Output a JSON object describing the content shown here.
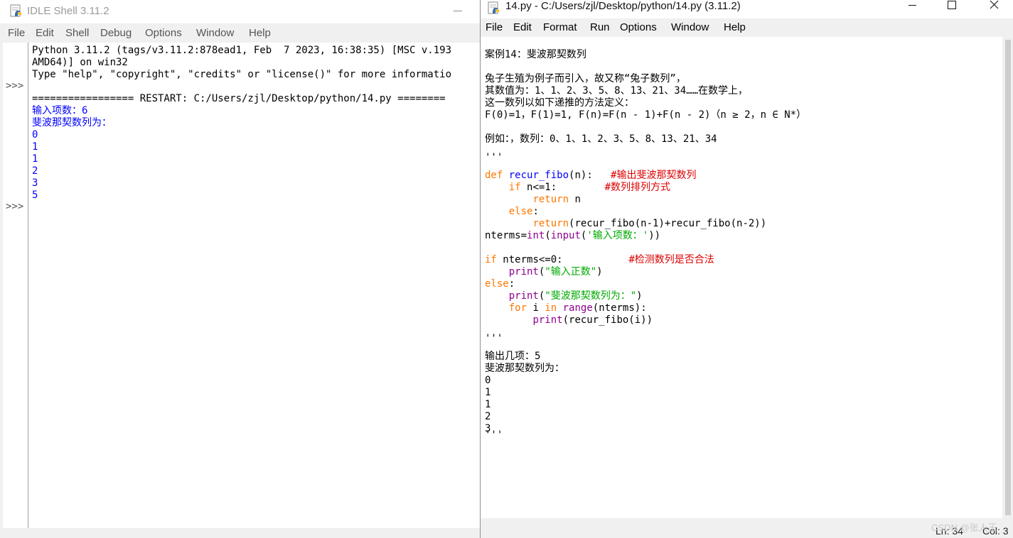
{
  "shell": {
    "title": "IDLE Shell 3.11.2",
    "menu": [
      "File",
      "Edit",
      "Shell",
      "Debug",
      "Options",
      "Window",
      "Help"
    ],
    "prompt": ">>>",
    "lines": [
      "Python 3.11.2 (tags/v3.11.2:878ead1, Feb  7 2023, 16:38:35) [MSC v.193",
      "AMD64)] on win32",
      "Type \"help\", \"copyright\", \"credits\" or \"license()\" for more informatio",
      "",
      "================= RESTART: C:/Users/zjl/Desktop/python/14.py ========",
      "输入项数：6",
      "斐波那契数列为：",
      "0",
      "1",
      "1",
      "2",
      "3",
      "5"
    ]
  },
  "editor": {
    "title": "14.py - C:/Users/zjl/Desktop/python/14.py (3.11.2)",
    "menu": [
      "File",
      "Edit",
      "Format",
      "Run",
      "Options",
      "Window",
      "Help"
    ],
    "code": {
      "l0": "'''",
      "l1": "案例14：斐波那契数列",
      "l3": "兔子生殖为例子而引入，故又称“兔子数列”，",
      "l4": "其数值为：1、1、2、3、5、8、13、21、34……在数学上，",
      "l5": "这一数列以如下递推的方法定义：",
      "l6": "F(0)=1，F(1)=1, F(n)=F(n - 1)+F(n - 2)（n ≥ 2，n ∈ N*）",
      "l8": "例如：，数列：0、1、1、2、3、5、8、13、21、34",
      "l10": "'''",
      "l12_kw": "def",
      "l12_fn": "recur_fibo",
      "l12_args": "(n):",
      "l12_cmt": "#输出斐波那契数列",
      "l13_kw": "if",
      "l13_rest": "n<=1:",
      "l13_cmt": "#数列排列方式",
      "l14_kw": "return",
      "l14_rest": "n",
      "l15_kw": "else",
      "l15_rest": ":",
      "l16_kw": "return",
      "l16_rest": "(recur_fibo(n-1)+recur_fibo(n-2))",
      "l17_a": "nterms=",
      "l17_int": "int",
      "l17_b": "(",
      "l17_input": "input",
      "l17_c": "(",
      "l17_str": "'输入项数：'",
      "l17_d": "))",
      "l19_kw": "if",
      "l19_rest": "nterms<=0:",
      "l19_cmt": "#检测数列是否合法",
      "l20_pr": "print",
      "l20_a": "(",
      "l20_str": "\"输入正数\"",
      "l20_b": ")",
      "l21_kw": "else",
      "l21_rest": ":",
      "l22_pr": "print",
      "l22_a": "(",
      "l22_str": "\"斐波那契数列为：\"",
      "l22_b": ")",
      "l23_for": "for",
      "l23_a": "i",
      "l23_in": "in",
      "l23_range": "range",
      "l23_b": "(nterms):",
      "l24_pr": "print",
      "l24_rest": "(recur_fibo(i))",
      "l26": "'''",
      "l27": "输出几项：5",
      "l28": "斐波那契数列为：",
      "l29": "0",
      "l30": "1",
      "l31": "1",
      "l32": "2",
      "l33": "3",
      "l34": "'''"
    },
    "status": {
      "line": "Ln: 34",
      "col": "Col: 3"
    },
    "watermark": "CSDN @张人王"
  },
  "colors": {
    "keyword": "#ff7700",
    "definition": "#0000ff",
    "builtin": "#900090",
    "string": "#00aa00",
    "comment": "#dd0000",
    "shell_output": "#0000ff"
  }
}
